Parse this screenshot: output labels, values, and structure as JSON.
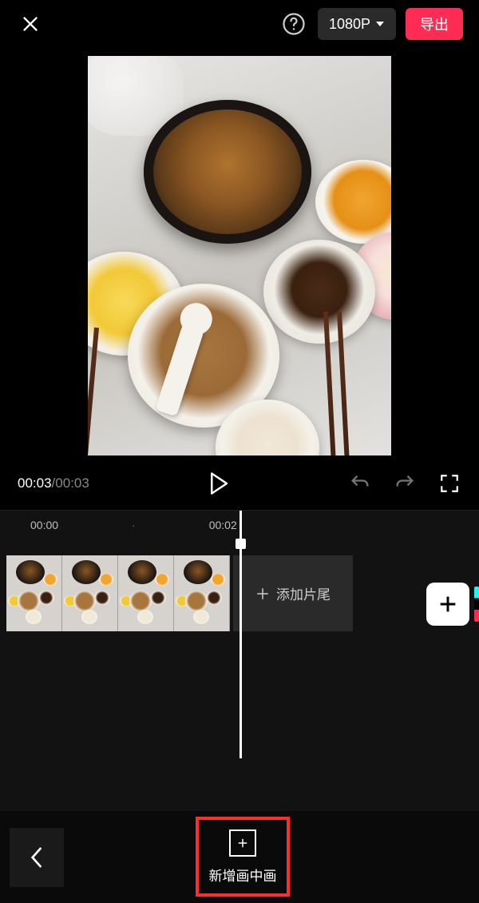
{
  "header": {
    "resolution": "1080P",
    "export_label": "导出"
  },
  "playback": {
    "current_time": "00:03",
    "separator": "/",
    "duration": "00:03"
  },
  "ruler": {
    "marks": [
      "00:00",
      "·",
      "00:02"
    ]
  },
  "end_card": {
    "label": "添加片尾"
  },
  "bottom": {
    "pip_label": "新增画中画"
  },
  "icons": {
    "close": "close-icon",
    "help": "help-icon",
    "dropdown": "chevron-down-icon",
    "play": "play-icon",
    "undo": "undo-icon",
    "redo": "redo-icon",
    "fullscreen": "fullscreen-icon",
    "plus": "plus-icon",
    "back": "chevron-left-icon"
  },
  "colors": {
    "accent": "#FE2C55",
    "highlight_border": "#FE2C2C"
  }
}
